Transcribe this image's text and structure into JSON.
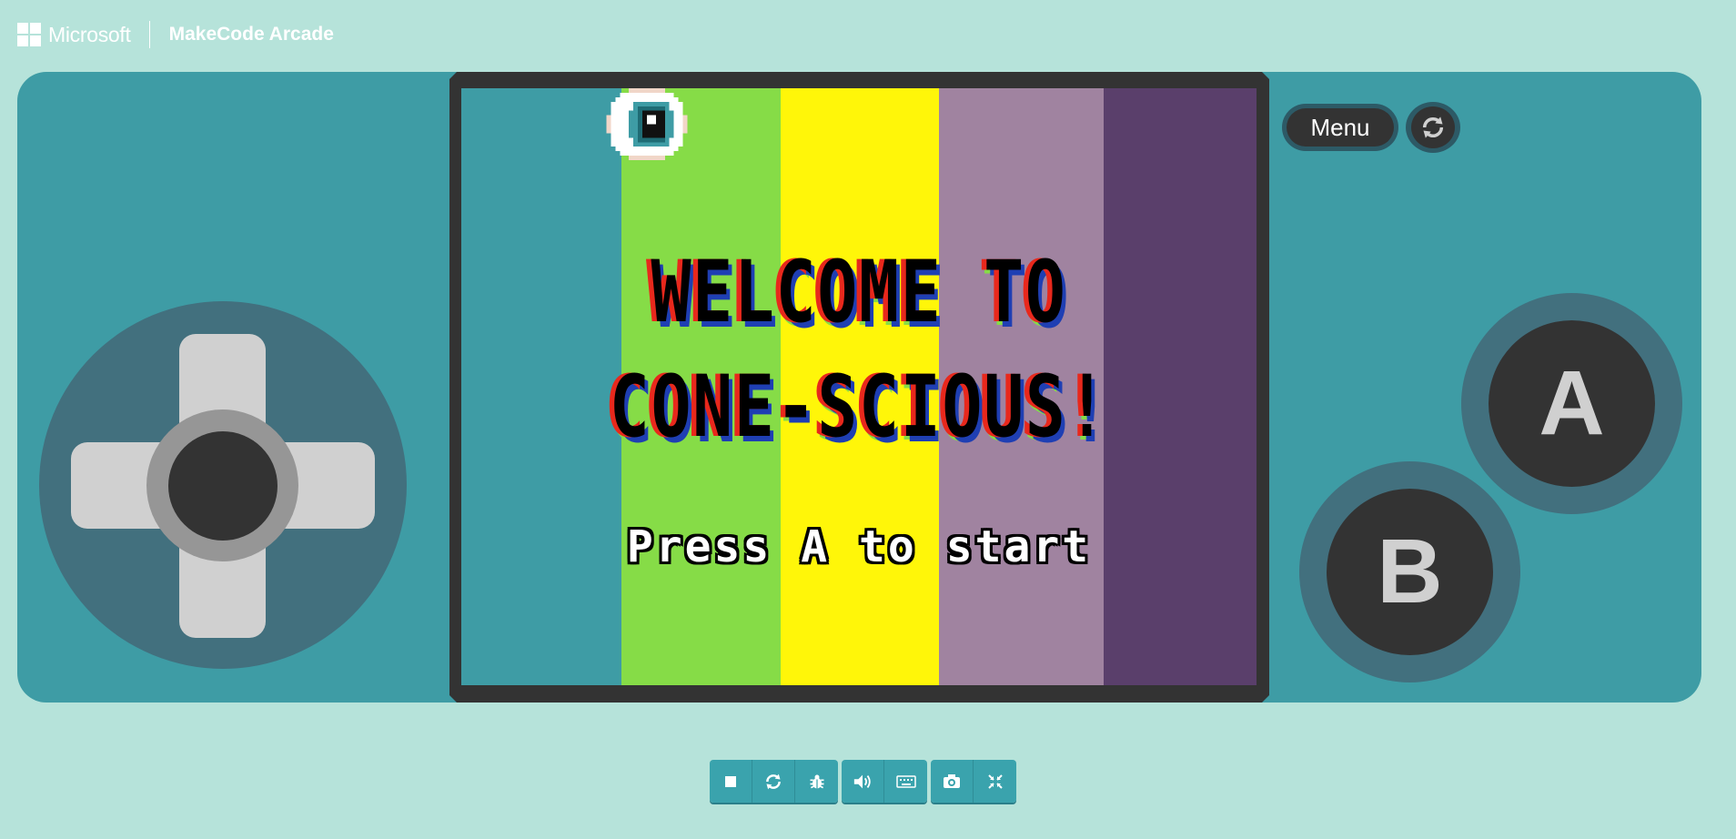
{
  "header": {
    "company": "Microsoft",
    "product": "MakeCode Arcade"
  },
  "game": {
    "title_line_1": "WELCOME TO",
    "title_line_2": "CONE-SCIOUS!",
    "prompt": "Press A to start",
    "stripe_colors": [
      "#3e9ca5",
      "#86dc47",
      "#fff609",
      "#a083a0",
      "#5a3f6b"
    ]
  },
  "controls": {
    "menu_label": "Menu",
    "a_label": "A",
    "b_label": "B"
  },
  "toolbar": {
    "groups": [
      [
        "stop-icon",
        "restart-icon",
        "debug-icon"
      ],
      [
        "sound-icon",
        "keyboard-icon"
      ],
      [
        "screenshot-icon",
        "settings-icon"
      ]
    ]
  },
  "colors": {
    "page_background": "#b6e3da",
    "console_body": "#3e9ca5",
    "button_ring": "#42707e",
    "button_face": "#333333"
  }
}
